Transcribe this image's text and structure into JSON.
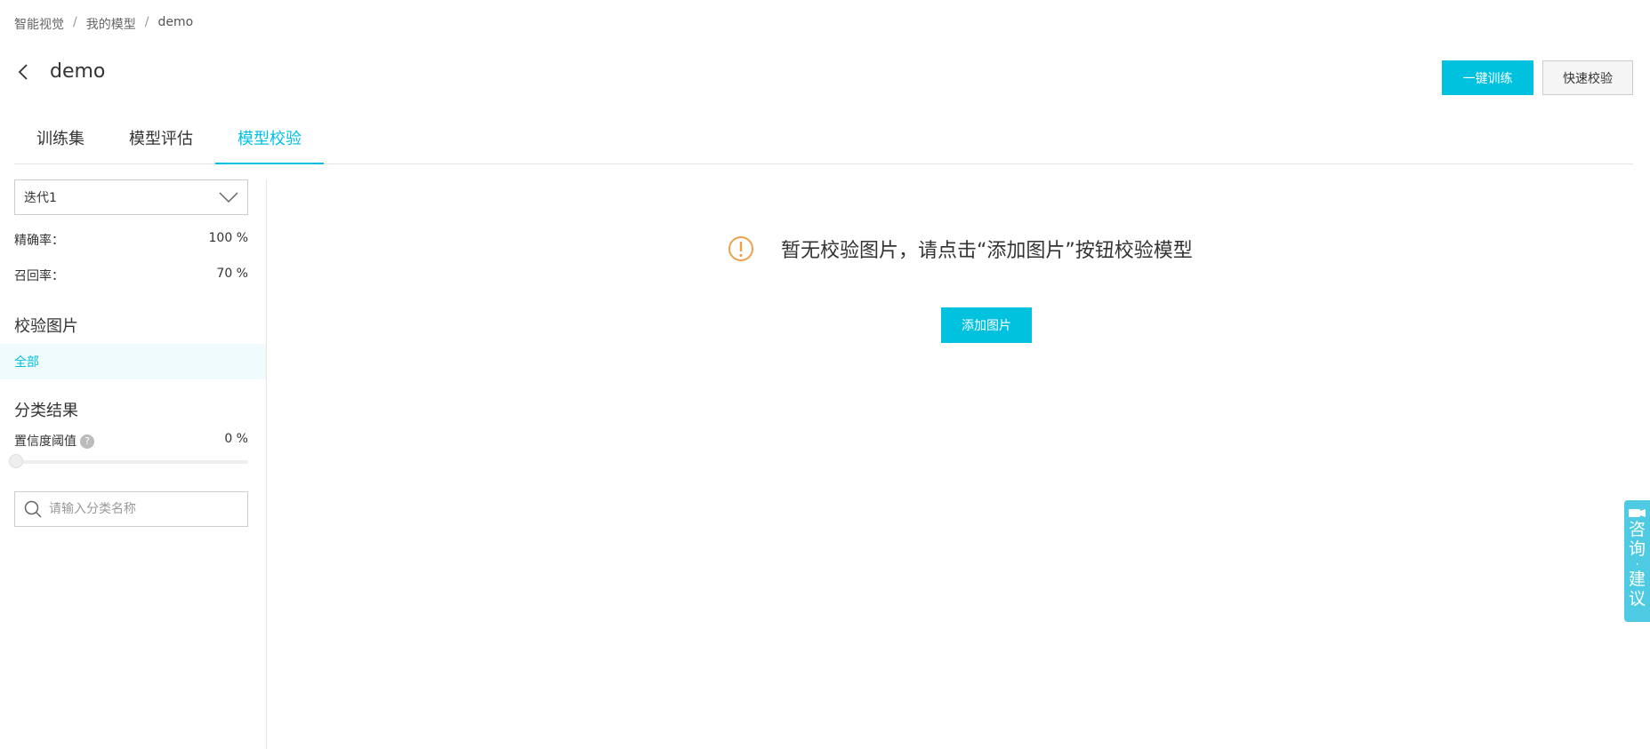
{
  "breadcrumb": {
    "items": [
      "智能视觉",
      "我的模型",
      "demo"
    ],
    "separator": "/"
  },
  "header": {
    "title": "demo",
    "primary_button": "一键训练",
    "secondary_button": "快速校验"
  },
  "tabs": [
    {
      "label": "训练集",
      "active": false
    },
    {
      "label": "模型评估",
      "active": false
    },
    {
      "label": "模型校验",
      "active": true
    }
  ],
  "sidebar": {
    "iteration_select": "迭代1",
    "precision": {
      "label": "精确率：",
      "value": "100 %"
    },
    "recall": {
      "label": "召回率：",
      "value": "70 %"
    },
    "verify_images_title": "校验图片",
    "filter_all": "全部",
    "classification_title": "分类结果",
    "confidence": {
      "label": "置信度阈值",
      "value": "0 %",
      "level": 0,
      "help": "?"
    },
    "search_placeholder": "请输入分类名称"
  },
  "main": {
    "empty_message": "暂无校验图片，请点击“添加图片”按钮校验模型",
    "add_button": "添加图片"
  },
  "float_panel": {
    "chars": [
      "咨",
      "询",
      "·",
      "建",
      "议"
    ]
  },
  "colors": {
    "accent": "#00c1de",
    "warning": "#f0a04b",
    "float_panel": "#4ecbe2"
  }
}
